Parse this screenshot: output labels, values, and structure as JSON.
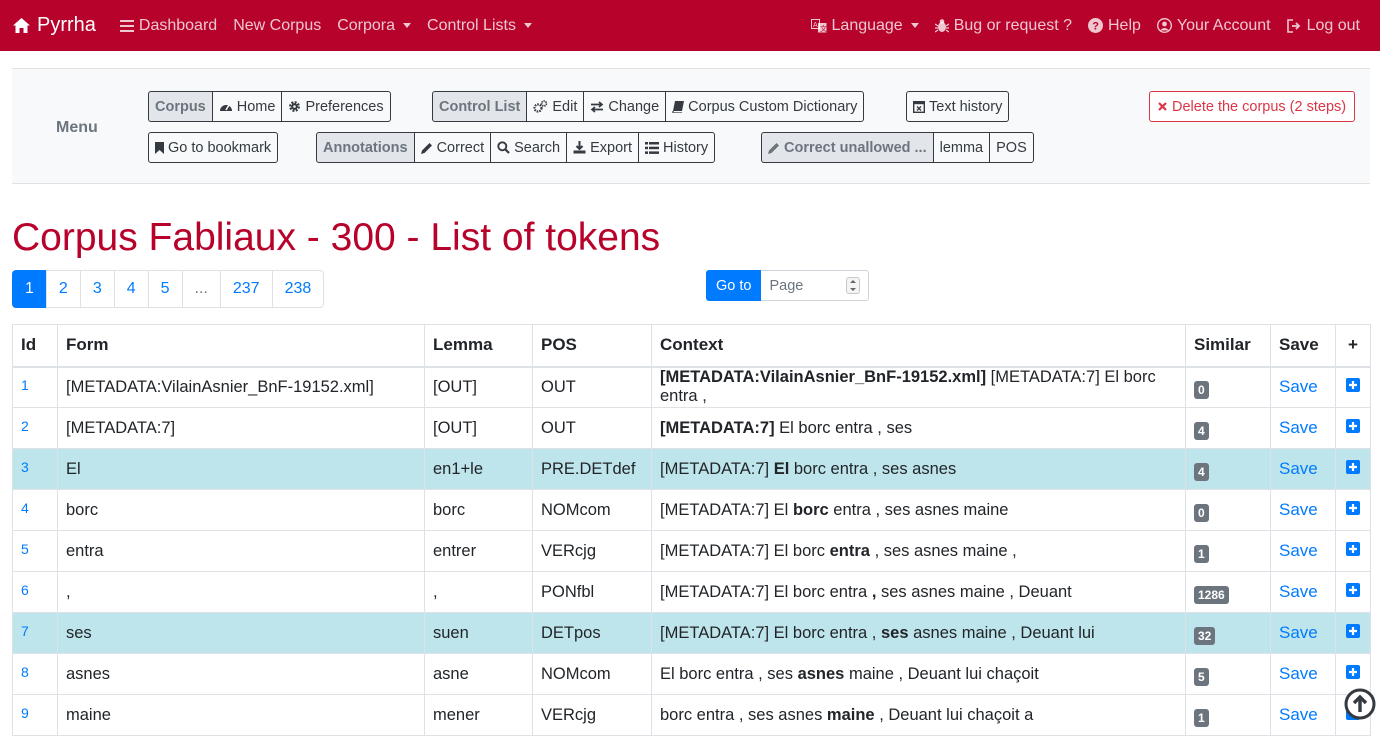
{
  "navbar": {
    "brand": "Pyrrha",
    "left": [
      {
        "label": "Dashboard",
        "icon": "bars-icon",
        "dropdown": false
      },
      {
        "label": "New Corpus",
        "dropdown": false
      },
      {
        "label": "Corpora",
        "dropdown": true
      },
      {
        "label": "Control Lists",
        "dropdown": true
      }
    ],
    "language": "Language",
    "bug": "Bug or request ?",
    "help": "Help",
    "account": "Your Account",
    "logout": "Log out"
  },
  "menu": {
    "label": "Menu",
    "corpus": {
      "head": "Corpus",
      "home": "Home",
      "preferences": "Preferences"
    },
    "bookmark": "Go to bookmark",
    "control_list": {
      "head": "Control List",
      "edit": "Edit",
      "change": "Change",
      "dictionary": "Corpus Custom Dictionary"
    },
    "annotations": {
      "head": "Annotations",
      "correct": "Correct",
      "search": "Search",
      "export": "Export",
      "history": "History"
    },
    "text_history": "Text history",
    "unallowed": {
      "head": "Correct unallowed ...",
      "lemma": "lemma",
      "pos": "POS"
    },
    "delete": "Delete the corpus (2 steps)"
  },
  "title": "Corpus Fabliaux - 300 - List of tokens",
  "pagination": [
    "1",
    "2",
    "3",
    "4",
    "5",
    "...",
    "237",
    "238"
  ],
  "goto": {
    "button": "Go to",
    "placeholder": "Page"
  },
  "table": {
    "headers": {
      "id": "Id",
      "form": "Form",
      "lemma": "Lemma",
      "pos": "POS",
      "context": "Context",
      "similar": "Similar",
      "save": "Save",
      "add": "+"
    },
    "rows": [
      {
        "id": "1",
        "form": "[METADATA:VilainAsnier_BnF-19152.xml]",
        "lemma": "[OUT]",
        "pos": "OUT",
        "ctx_before": "",
        "ctx_token": "[METADATA:VilainAsnier_BnF-19152.xml]",
        "ctx_after": " [METADATA:7] El borc entra ,",
        "similar": "0",
        "save": "Save",
        "highlight": false
      },
      {
        "id": "2",
        "form": "[METADATA:7]",
        "lemma": "[OUT]",
        "pos": "OUT",
        "ctx_before": "",
        "ctx_token": "[METADATA:7]",
        "ctx_after": " El borc entra , ses",
        "similar": "4",
        "save": "Save",
        "highlight": false
      },
      {
        "id": "3",
        "form": "El",
        "lemma": "en1+le",
        "pos": "PRE.DETdef",
        "ctx_before": "[METADATA:7] ",
        "ctx_token": "El",
        "ctx_after": " borc entra , ses asnes",
        "similar": "4",
        "save": "Save",
        "highlight": true
      },
      {
        "id": "4",
        "form": "borc",
        "lemma": "borc",
        "pos": "NOMcom",
        "ctx_before": "[METADATA:7] El ",
        "ctx_token": "borc",
        "ctx_after": " entra , ses asnes maine",
        "similar": "0",
        "save": "Save",
        "highlight": false
      },
      {
        "id": "5",
        "form": "entra",
        "lemma": "entrer",
        "pos": "VERcjg",
        "ctx_before": "[METADATA:7] El borc ",
        "ctx_token": "entra",
        "ctx_after": " , ses asnes maine ,",
        "similar": "1",
        "save": "Save",
        "highlight": false
      },
      {
        "id": "6",
        "form": ",",
        "lemma": ",",
        "pos": "PONfbl",
        "ctx_before": "[METADATA:7] El borc entra ",
        "ctx_token": ",",
        "ctx_after": " ses asnes maine , Deuant",
        "similar": "1286",
        "save": "Save",
        "highlight": false
      },
      {
        "id": "7",
        "form": "ses",
        "lemma": "suen",
        "pos": "DETpos",
        "ctx_before": "[METADATA:7] El borc entra , ",
        "ctx_token": "ses",
        "ctx_after": " asnes maine , Deuant lui",
        "similar": "32",
        "save": "Save",
        "highlight": true
      },
      {
        "id": "8",
        "form": "asnes",
        "lemma": "asne",
        "pos": "NOMcom",
        "ctx_before": "El borc entra , ses ",
        "ctx_token": "asnes",
        "ctx_after": " maine , Deuant lui chaçoit",
        "similar": "5",
        "save": "Save",
        "highlight": false
      },
      {
        "id": "9",
        "form": "maine",
        "lemma": "mener",
        "pos": "VERcjg",
        "ctx_before": "borc entra , ses asnes ",
        "ctx_token": "maine",
        "ctx_after": " , Deuant lui chaçoit a",
        "similar": "1",
        "save": "Save",
        "highlight": false
      }
    ]
  },
  "colors": {
    "brand": "#b7022b",
    "link": "#007bff",
    "highlight_row": "#bee5eb",
    "badge": "#6c757d",
    "danger": "#dc3545"
  }
}
